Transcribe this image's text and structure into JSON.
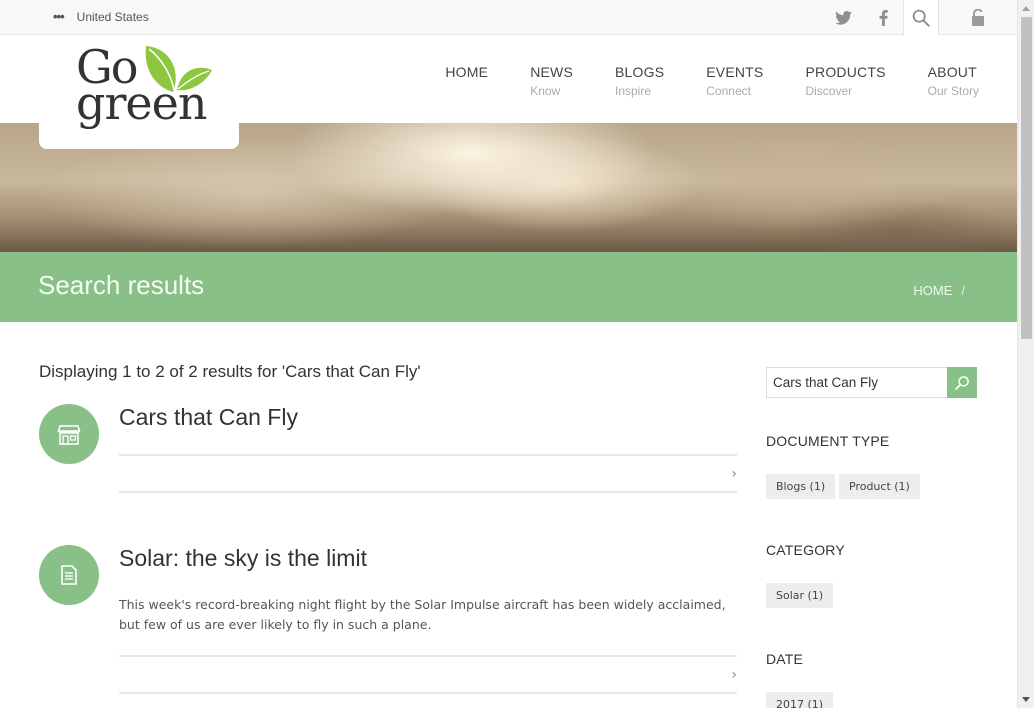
{
  "topbar": {
    "locale": "United States",
    "icons": [
      "twitter-icon",
      "facebook-icon",
      "search-icon",
      "lock-icon"
    ]
  },
  "logo": {
    "line1": "Go",
    "line2": "green"
  },
  "nav": [
    {
      "label": "HOME",
      "sub": ""
    },
    {
      "label": "NEWS",
      "sub": "Know"
    },
    {
      "label": "BLOGS",
      "sub": "Inspire"
    },
    {
      "label": "EVENTS",
      "sub": "Connect"
    },
    {
      "label": "PRODUCTS",
      "sub": "Discover"
    },
    {
      "label": "ABOUT",
      "sub": "Our Story"
    }
  ],
  "page": {
    "title": "Search results",
    "breadcrumb": "HOME",
    "breadcrumb_sep": "/"
  },
  "results": {
    "summary": "Displaying 1 to 2 of 2 results for 'Cars that Can Fly'",
    "items": [
      {
        "title": "Cars that Can Fly",
        "description": "",
        "icon": "store-icon"
      },
      {
        "title": "Solar: the sky is the limit",
        "description": "This week's record-breaking night flight by the Solar Impulse aircraft has been widely acclaimed, but few of us are ever likely to fly in such a plane.",
        "icon": "document-icon"
      }
    ],
    "chevron": "›"
  },
  "sidebar": {
    "search_value": "Cars that Can Fly",
    "facets": [
      {
        "heading": "DOCUMENT TYPE",
        "chips": [
          "Blogs (1)",
          "Product (1)"
        ]
      },
      {
        "heading": "CATEGORY",
        "chips": [
          "Solar (1)"
        ]
      },
      {
        "heading": "DATE",
        "chips": [
          "2017 (1)"
        ]
      }
    ]
  },
  "colors": {
    "accent": "#88c087",
    "chip_bg": "#ededed",
    "leaf_green": "#8dc63f"
  }
}
